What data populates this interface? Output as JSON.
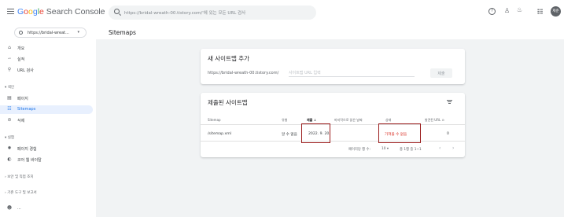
{
  "header": {
    "logo": {
      "g1": "G",
      "g2": "o",
      "g3": "o",
      "g4": "g",
      "g5": "l",
      "g6": "e",
      "rest": " Search Console"
    },
    "search_placeholder": "https://bridal-wreath-00.tistory.com/'에 있는 모든 URL 검사",
    "avatar_initials": "제준"
  },
  "property": {
    "label": "https://bridal-wreat...",
    "caret": "▾"
  },
  "page": {
    "title": "Sitemaps"
  },
  "sidebar": {
    "items": [
      {
        "icon": "home-icon",
        "label": "개요"
      },
      {
        "icon": "trending-icon",
        "label": "실적"
      },
      {
        "icon": "search-icon",
        "label": "URL 검사"
      },
      {
        "section": "▾ 색인"
      },
      {
        "icon": "page-icon",
        "label": "페이지"
      },
      {
        "icon": "sitemap-icon",
        "label": "Sitemaps"
      },
      {
        "icon": "remove-icon",
        "label": "삭제"
      },
      {
        "section": "▾ 실험"
      },
      {
        "icon": "gear-icon",
        "label": "페이지 경험"
      },
      {
        "icon": "gauge-icon",
        "label": "코어 웹 바이탈"
      },
      {
        "section": "› 보안 및 직접 조치"
      },
      {
        "section": "› 기존 도구 및 보고서"
      },
      {
        "icon": "people-icon",
        "label": "..."
      }
    ]
  },
  "add_sitemap": {
    "title": "새 사이트맵 추가",
    "url_prefix": "https://bridal-wreath-00.tistory.com/",
    "input_placeholder": "사이트맵 URL 입력",
    "submit_label": "제출"
  },
  "submitted": {
    "title": "제출된 사이트맵",
    "columns": [
      "Sitemap",
      "유형",
      "제출 ↓",
      "마지막으로 읽은 날짜",
      "상태",
      "발견된 URL ⊙"
    ],
    "rows": [
      {
        "sitemap": "/sitemap.xml",
        "type": "알 수 없음",
        "submitted": "2022. 9. 20.",
        "last_read": "",
        "status": "가져올 수 없음",
        "discovered": "0"
      }
    ],
    "pager": {
      "rows_per_page_label": "페이지당 행 수:",
      "rows_per_page": "10 ▾",
      "range": "총 1행 중 1~1"
    }
  }
}
